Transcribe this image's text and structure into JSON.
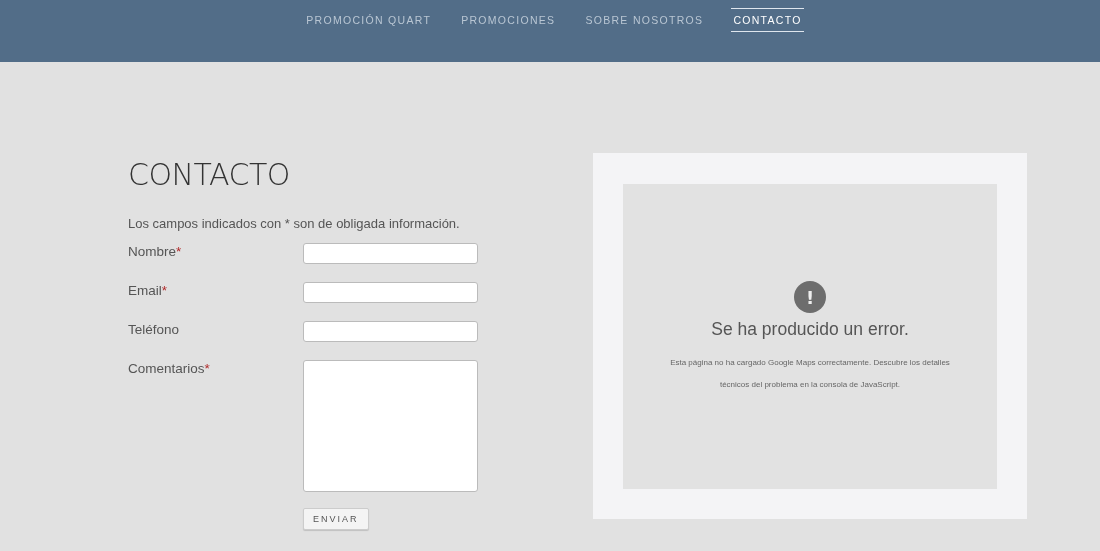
{
  "nav": {
    "items": [
      {
        "label": "PROMOCIÓN QUART",
        "selected": false
      },
      {
        "label": "PROMOCIONES",
        "selected": false
      },
      {
        "label": "SOBRE NOSOTROS",
        "selected": false
      },
      {
        "label": "CONTACTO",
        "selected": true
      }
    ]
  },
  "contact": {
    "title": "CONTACTO",
    "note": "Los campos indicados con * son de obligada información.",
    "fields": [
      {
        "label": "Nombre",
        "mark": "*",
        "kind": "input"
      },
      {
        "label": "Email",
        "mark": "*",
        "kind": "input"
      },
      {
        "label": "Teléfono",
        "kind": "input"
      },
      {
        "label": "Comentarios",
        "mark": "*",
        "kind": "textarea"
      }
    ],
    "submit": "ENVIAR"
  },
  "map": {
    "icon": "!",
    "error_title": "Se ha producido un error.",
    "error_text": "Esta página no ha cargado Google Maps correctamente. Descubre los detalles técnicos del problema en la consola de JavaScript."
  }
}
